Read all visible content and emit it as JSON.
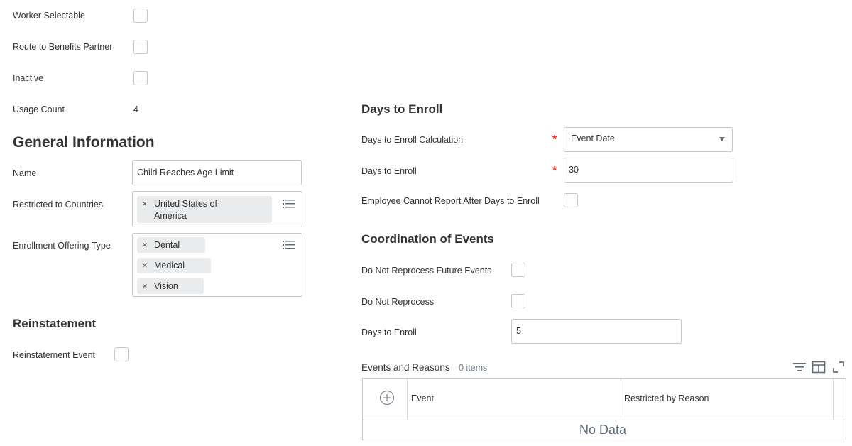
{
  "left_fields": {
    "worker_selectable": "Worker Selectable",
    "route_to_benefits_partner": "Route to Benefits Partner",
    "inactive": "Inactive",
    "usage_count_label": "Usage Count",
    "usage_count_value": "4"
  },
  "general_information": {
    "heading": "General Information",
    "name_label": "Name",
    "name_value": "Child Reaches Age Limit",
    "restricted_label": "Restricted to Countries",
    "restricted_values": [
      "United States of",
      "America"
    ],
    "enrollment_label": "Enrollment Offering Type",
    "enrollment_values": [
      "Dental",
      "Medical",
      "Vision"
    ],
    "remove_glyph": "×"
  },
  "reinstatement": {
    "heading": "Reinstatement",
    "event_label": "Reinstatement Event"
  },
  "days_to_enroll": {
    "heading": "Days to Enroll",
    "calculation_label": "Days to Enroll Calculation",
    "calculation_value": "Event Date",
    "days_label": "Days to Enroll",
    "days_value": "30",
    "cannot_report_label": "Employee Cannot Report After Days to Enroll",
    "required_mark": "*"
  },
  "coordination": {
    "heading": "Coordination of Events",
    "no_reprocess_future_label": "Do Not Reprocess Future Events",
    "no_reprocess_label": "Do Not Reprocess",
    "days_label": "Days to Enroll",
    "days_value": "5"
  },
  "events_table": {
    "title": "Events and Reasons",
    "count": "0 items",
    "columns": [
      "Event",
      "Restricted by Reason"
    ],
    "empty_text": "No Data",
    "add_glyph": "+"
  },
  "colors": {
    "required": "#de2e21",
    "border": "#c7c7c7",
    "pill_bg": "#e9ebed",
    "text": "#333333"
  }
}
